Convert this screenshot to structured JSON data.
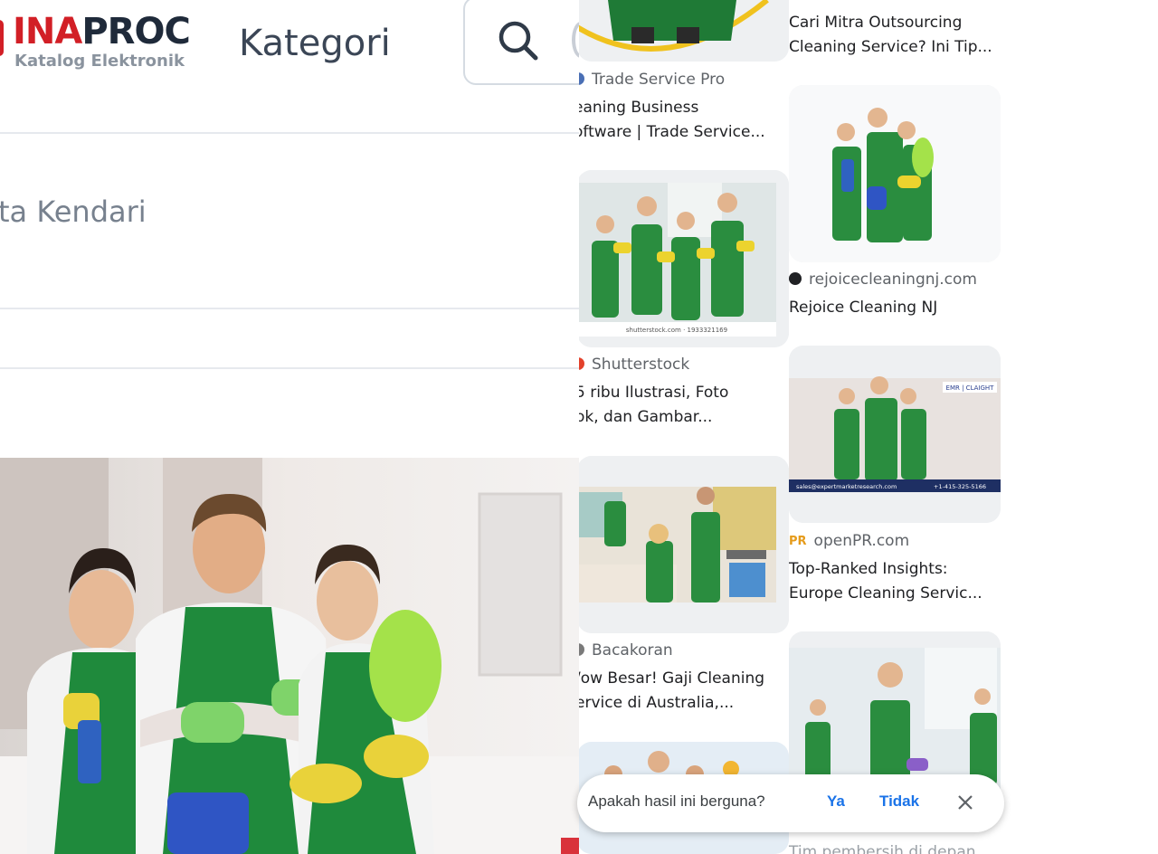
{
  "left": {
    "logo": {
      "brand_red": "INA",
      "brand_dark": "PROC",
      "subtitle": "Katalog Elektronik"
    },
    "header_title": "Kategori",
    "location_text": "ta Kendari",
    "search_icon": "search-icon",
    "colors": {
      "brand_red": "#d21f26",
      "text_dark": "#1f2a3a"
    }
  },
  "right": {
    "results": [
      {
        "source": "Trade Service Pro",
        "title_l1": "eaning Business",
        "title_l2": "oftware | Trade Service..."
      },
      {
        "source": "Shutterstock",
        "title_l1": "5 ribu Ilustrasi, Foto",
        "title_l2": "ok, dan Gambar...",
        "caption": "shutterstock.com · 1933321169"
      },
      {
        "source": "Bacakoran",
        "title_l1": "/ow Besar! Gaji Cleaning",
        "title_l2": "ervice di Australia,..."
      },
      {
        "title_l1": "Cari Mitra Outsourcing",
        "title_l2": "Cleaning Service? Ini Tip..."
      },
      {
        "source": "rejoicecleaningnj.com",
        "title_l1": "Rejoice Cleaning NJ"
      },
      {
        "source": "openPR.com",
        "source_badge": "PR",
        "title_l1": "Top-Ranked Insights:",
        "title_l2": "Europe Cleaning Servic...",
        "banner_left": "sales@expertmarketresearch.com",
        "banner_right": "+1-415-325-5166",
        "logo_text": "EMR | CLAIGHT"
      }
    ],
    "feedback": {
      "question": "Apakah hasil ini berguna?",
      "yes": "Ya",
      "no": "Tidak"
    },
    "peek_text": "Tim pembersih di depan",
    "colors": {
      "link_blue": "#1a73e8",
      "apron_green": "#1f8a3c",
      "glove_yellow": "#e9d23a"
    }
  }
}
